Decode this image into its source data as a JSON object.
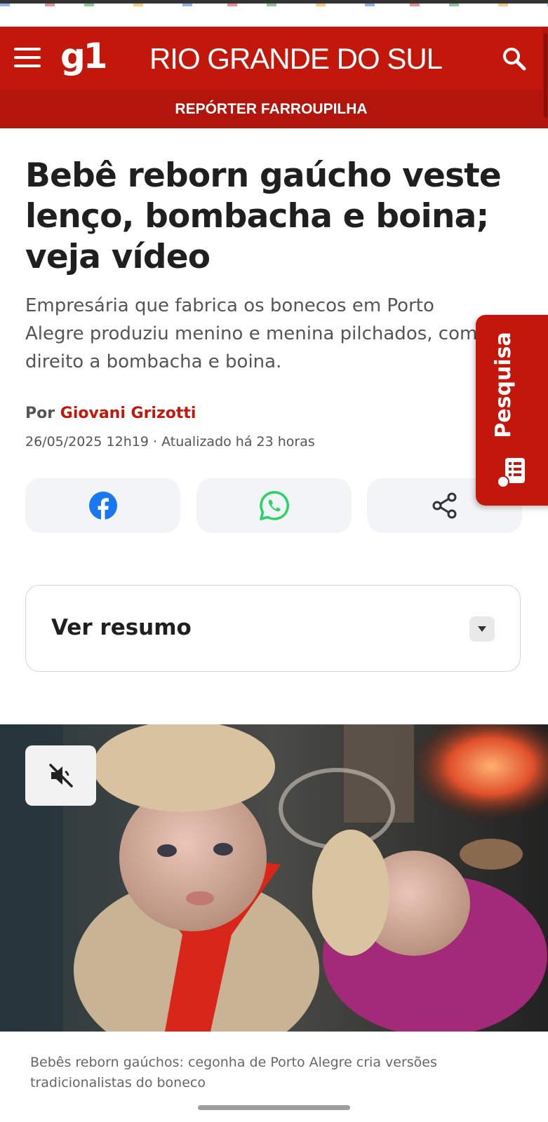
{
  "header": {
    "logo_text": "g1",
    "region": "RIO GRANDE DO SUL",
    "section": "REPÓRTER FARROUPILHA"
  },
  "article": {
    "headline": "Bebê reborn gaúcho veste lenço, bombacha e boina; veja vídeo",
    "subtitle": "Empresária que fabrica os bonecos em Porto Alegre produziu menino e menina pilchados, com direito a bombacha e boina.",
    "byline_prefix": "Por",
    "author": "Giovani Grizotti",
    "date": "26/05/2025 12h19",
    "updated": "Atualizado há 23 horas"
  },
  "summary": {
    "label": "Ver resumo"
  },
  "media": {
    "caption": "Bebês reborn gaúchos: cegonha de Porto Alegre cria versões tradicionalistas do boneco"
  },
  "side_tab": {
    "label": "Pesquisa"
  },
  "icons": {
    "menu": "hamburger-icon",
    "search": "search-icon",
    "facebook": "facebook-icon",
    "whatsapp": "whatsapp-icon",
    "share": "share-icon",
    "summary_toggle": "caret-down-icon",
    "mute": "muted-speaker-icon",
    "survey": "survey-icon"
  },
  "colors": {
    "brand_red": "#c4170c",
    "subbar_red": "#b2150b",
    "facebook_blue": "#1877f2",
    "whatsapp_green": "#25d366"
  }
}
